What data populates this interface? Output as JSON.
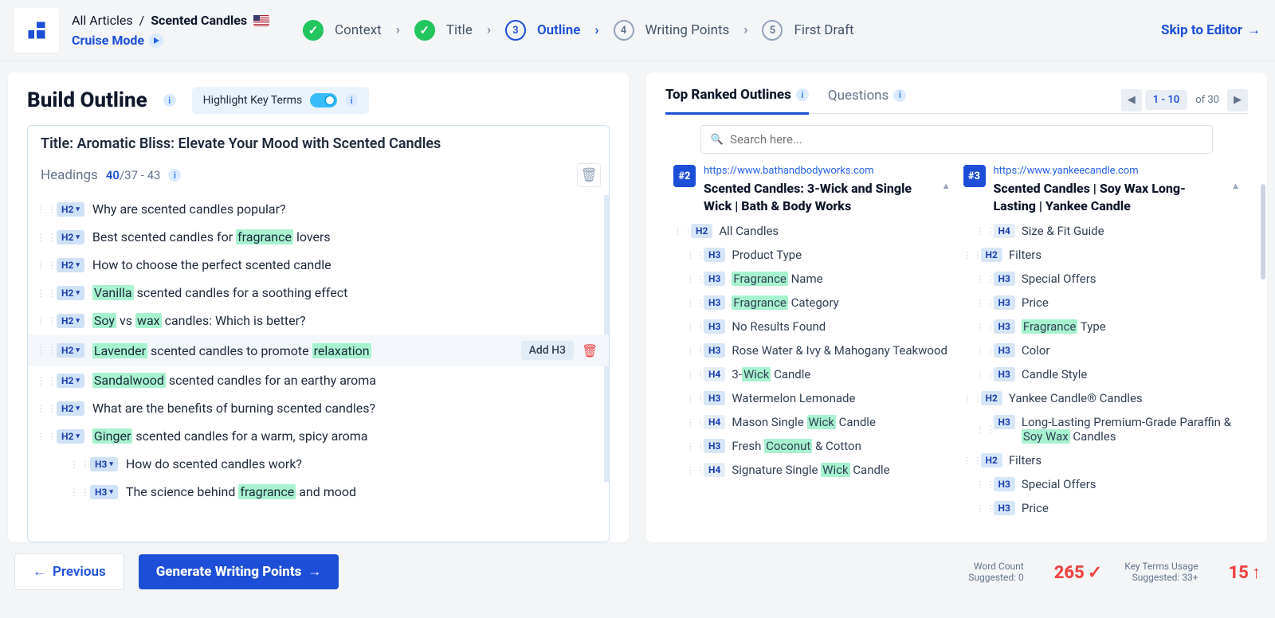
{
  "header": {
    "breadcrumb_root": "All Articles",
    "breadcrumb_current": "Scented Candles",
    "cruise_label": "Cruise Mode"
  },
  "steps": {
    "context": "Context",
    "title": "Title",
    "outline": "Outline",
    "writing_points": "Writing Points",
    "first_draft": "First Draft",
    "outline_num": "3",
    "wp_num": "4",
    "fd_num": "5",
    "skip": "Skip to Editor"
  },
  "left": {
    "heading": "Build Outline",
    "highlight_label": "Highlight Key Terms",
    "title_prefix": "Title: ",
    "title_text": "Aromatic Bliss: Elevate Your Mood with Scented Candles",
    "headings_label": "Headings",
    "headings_count": "40",
    "headings_range": "/37 - 43",
    "add_h3": "Add H3"
  },
  "outline": [
    {
      "level": "H2",
      "indent": 0,
      "segments": [
        {
          "t": "Why are scented candles popular?"
        }
      ]
    },
    {
      "level": "H2",
      "indent": 0,
      "segments": [
        {
          "t": "Best scented candles for "
        },
        {
          "t": "fragrance",
          "hl": true
        },
        {
          "t": " lovers"
        }
      ]
    },
    {
      "level": "H2",
      "indent": 0,
      "segments": [
        {
          "t": "How to choose the perfect scented candle"
        }
      ]
    },
    {
      "level": "H2",
      "indent": 0,
      "segments": [
        {
          "t": "Vanilla",
          "hl": true
        },
        {
          "t": " scented candles for a soothing effect"
        }
      ]
    },
    {
      "level": "H2",
      "indent": 0,
      "segments": [
        {
          "t": "Soy",
          "hl": true
        },
        {
          "t": " vs "
        },
        {
          "t": "wax",
          "hl": true
        },
        {
          "t": " candles: Which is better?"
        }
      ]
    },
    {
      "level": "H2",
      "indent": 0,
      "hover": true,
      "segments": [
        {
          "t": "Lavender",
          "hl": true
        },
        {
          "t": " scented candles to promote "
        },
        {
          "t": "relaxation",
          "hl": true
        }
      ]
    },
    {
      "level": "H2",
      "indent": 0,
      "segments": [
        {
          "t": "Sandalwood",
          "hl": true
        },
        {
          "t": " scented candles for an earthy aroma"
        }
      ]
    },
    {
      "level": "H2",
      "indent": 0,
      "segments": [
        {
          "t": "What are the benefits of burning scented candles?"
        }
      ]
    },
    {
      "level": "H2",
      "indent": 0,
      "segments": [
        {
          "t": "Ginger",
          "hl": true
        },
        {
          "t": " scented candles for a warm, spicy aroma"
        }
      ]
    },
    {
      "level": "H3",
      "indent": 1,
      "segments": [
        {
          "t": "How do scented candles work?"
        }
      ]
    },
    {
      "level": "H3",
      "indent": 1,
      "segments": [
        {
          "t": "The science behind "
        },
        {
          "t": "fragrance",
          "hl": true
        },
        {
          "t": " and mood"
        }
      ]
    }
  ],
  "right": {
    "tab_outlines": "Top Ranked Outlines",
    "tab_questions": "Questions",
    "pager_range": "1 - 10",
    "pager_of": "of 30",
    "search_ph": "Search here..."
  },
  "cards": [
    {
      "rank": "#2",
      "url": "https://www.bathandbodyworks.com",
      "title": "Scented Candles: 3-Wick and Single Wick | Bath & Body Works",
      "items": [
        {
          "lvl": "H2",
          "ind": 0,
          "seg": [
            {
              "t": "All Candles"
            }
          ]
        },
        {
          "lvl": "H3",
          "ind": 1,
          "seg": [
            {
              "t": "Product Type"
            }
          ]
        },
        {
          "lvl": "H3",
          "ind": 1,
          "seg": [
            {
              "t": "Fragrance",
              "hl": true
            },
            {
              "t": " Name"
            }
          ]
        },
        {
          "lvl": "H3",
          "ind": 1,
          "seg": [
            {
              "t": "Fragrance",
              "hl": true
            },
            {
              "t": " Category"
            }
          ]
        },
        {
          "lvl": "H3",
          "ind": 1,
          "seg": [
            {
              "t": "No Results Found"
            }
          ]
        },
        {
          "lvl": "H3",
          "ind": 1,
          "seg": [
            {
              "t": "Rose Water & Ivy & Mahogany Teakwood"
            }
          ]
        },
        {
          "lvl": "H4",
          "ind": 1,
          "seg": [
            {
              "t": "3-"
            },
            {
              "t": "Wick",
              "hl": true
            },
            {
              "t": " Candle"
            }
          ]
        },
        {
          "lvl": "H3",
          "ind": 1,
          "seg": [
            {
              "t": "Watermelon Lemonade"
            }
          ]
        },
        {
          "lvl": "H4",
          "ind": 1,
          "seg": [
            {
              "t": "Mason Single "
            },
            {
              "t": "Wick",
              "hl": true
            },
            {
              "t": " Candle"
            }
          ]
        },
        {
          "lvl": "H3",
          "ind": 1,
          "seg": [
            {
              "t": "Fresh "
            },
            {
              "t": "Coconut",
              "hl": true
            },
            {
              "t": " & Cotton"
            }
          ]
        },
        {
          "lvl": "H4",
          "ind": 1,
          "seg": [
            {
              "t": "Signature Single "
            },
            {
              "t": "Wick",
              "hl": true
            },
            {
              "t": " Candle"
            }
          ]
        }
      ]
    },
    {
      "rank": "#3",
      "url": "https://www.yankeecandle.com",
      "title": "Scented Candles | Soy Wax Long-Lasting | Yankee Candle",
      "items": [
        {
          "lvl": "H4",
          "ind": 1,
          "seg": [
            {
              "t": "Size & Fit Guide"
            }
          ]
        },
        {
          "lvl": "H2",
          "ind": 0,
          "seg": [
            {
              "t": "Filters"
            }
          ]
        },
        {
          "lvl": "H3",
          "ind": 1,
          "seg": [
            {
              "t": "Special Offers"
            }
          ]
        },
        {
          "lvl": "H3",
          "ind": 1,
          "seg": [
            {
              "t": "Price"
            }
          ]
        },
        {
          "lvl": "H3",
          "ind": 1,
          "seg": [
            {
              "t": "Fragrance",
              "hl": true
            },
            {
              "t": " Type"
            }
          ]
        },
        {
          "lvl": "H3",
          "ind": 1,
          "seg": [
            {
              "t": "Color"
            }
          ]
        },
        {
          "lvl": "H3",
          "ind": 1,
          "seg": [
            {
              "t": "Candle Style"
            }
          ]
        },
        {
          "lvl": "H2",
          "ind": 0,
          "seg": [
            {
              "t": "Yankee Candle® Candles"
            }
          ]
        },
        {
          "lvl": "H3",
          "ind": 1,
          "seg": [
            {
              "t": "Long-Lasting Premium-Grade Paraffin & "
            },
            {
              "t": "Soy Wax",
              "hl": true
            },
            {
              "t": " Candles"
            }
          ]
        },
        {
          "lvl": "H2",
          "ind": 0,
          "seg": [
            {
              "t": "Filters"
            }
          ]
        },
        {
          "lvl": "H3",
          "ind": 1,
          "seg": [
            {
              "t": "Special Offers"
            }
          ]
        },
        {
          "lvl": "H3",
          "ind": 1,
          "seg": [
            {
              "t": "Price"
            }
          ]
        }
      ]
    }
  ],
  "footer": {
    "prev": "Previous",
    "gen": "Generate Writing Points",
    "wc_label": "Word Count",
    "wc_sugg": "Suggested: 0",
    "wc_val": "265",
    "kt_label": "Key Terms Usage",
    "kt_sugg": "Suggested: 33+",
    "kt_val": "15"
  }
}
